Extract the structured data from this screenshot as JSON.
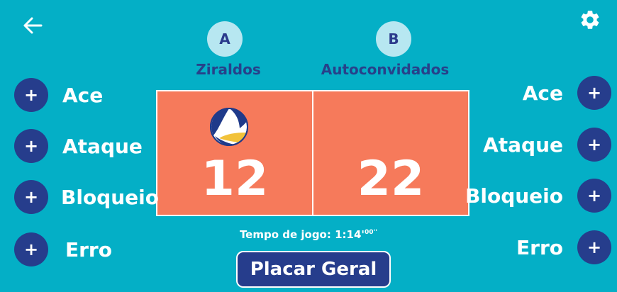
{
  "header": {
    "back_icon": "arrow-left-icon",
    "settings_icon": "gear-icon"
  },
  "teams": {
    "a": {
      "badge": "A",
      "name": "Ziraldos",
      "score": "12",
      "serving": true
    },
    "b": {
      "badge": "B",
      "name": "Autoconvidados",
      "score": "22",
      "serving": false
    }
  },
  "stats_left": [
    "Ace",
    "Ataque",
    "Bloqueio",
    "Erro"
  ],
  "stats_right": [
    "Ace",
    "Ataque",
    "Bloqueio",
    "Erro"
  ],
  "plus_symbol": "+",
  "game_time": {
    "label": "Tempo de jogo: 1:14'",
    "seconds": "00''"
  },
  "placar_button": "Placar Geral",
  "colors": {
    "background": "#04afc6",
    "court": "#f67a5b",
    "button": "#263d8c",
    "team_name": "#27418a",
    "badge": "#b7e7f1"
  }
}
